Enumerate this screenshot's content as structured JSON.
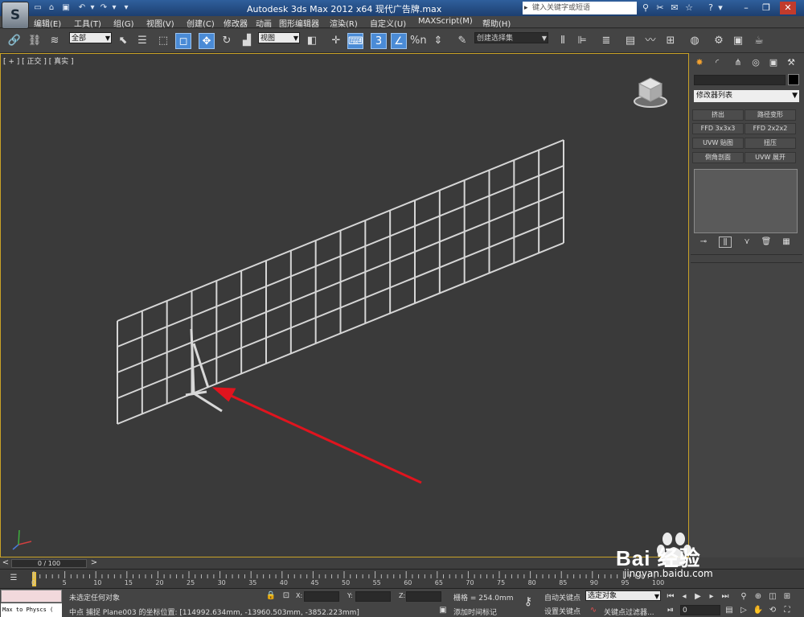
{
  "app": {
    "title": "Autodesk 3ds Max  2012 x64     现代广告牌.max",
    "search_placeholder": "键入关键字或短语"
  },
  "menu": {
    "items": [
      "编辑(E)",
      "工具(T)",
      "组(G)",
      "视图(V)",
      "创建(C)",
      "修改器",
      "动画",
      "图形编辑器",
      "渲染(R)",
      "自定义(U)",
      "MAXScript(M)",
      "帮助(H)"
    ]
  },
  "toolbar": {
    "selection_filter": "全部",
    "ref_coord": "视图",
    "named_selection": "创建选择集",
    "snap_number": "3",
    "angle_snap_label": "%n"
  },
  "viewport": {
    "label": "[ + ] [ 正交 ] [ 真实 ]"
  },
  "command_panel": {
    "modifier_list": "修改器列表",
    "modifier_buttons": [
      "挤出",
      "路径变形",
      "FFD 3x3x3",
      "FFD 2x2x2",
      "UVW 贴图",
      "扭压",
      "倒角剖面",
      "UVW 展开"
    ]
  },
  "timeline": {
    "frame_display": "0 / 100",
    "ticks": [
      "0",
      "5",
      "10",
      "15",
      "20",
      "25",
      "30",
      "35",
      "40",
      "45",
      "50",
      "55",
      "60",
      "65",
      "70",
      "75",
      "80",
      "85",
      "90",
      "95",
      "100"
    ]
  },
  "status": {
    "maxscript_listener": "Max to Physcs ( ",
    "selection_status": "未选定任何对象",
    "prompt": "中点  捕捉 Plane003 的坐标位置: [114992.634mm, -13960.503mm, -3852.223mm]",
    "x_label": "X:",
    "y_label": "Y:",
    "z_label": "Z:",
    "grid": "栅格 = 254.0mm",
    "add_time_tag": "添加时间标记",
    "auto_key": "自动关键点",
    "set_key": "设置关键点",
    "key_mode": "选定对象",
    "key_filters": "关键点过滤器...",
    "current_frame": "0"
  },
  "watermark": {
    "brand": "Bai 经验",
    "url": "jingyan.baidu.com"
  },
  "colors": {
    "viewport_bg": "#3a3a3a",
    "viewport_border": "#c9a227",
    "title_bar": "#2f5f9c",
    "annotation_arrow": "#e0141e",
    "model_wire": "#d6d6d6"
  }
}
